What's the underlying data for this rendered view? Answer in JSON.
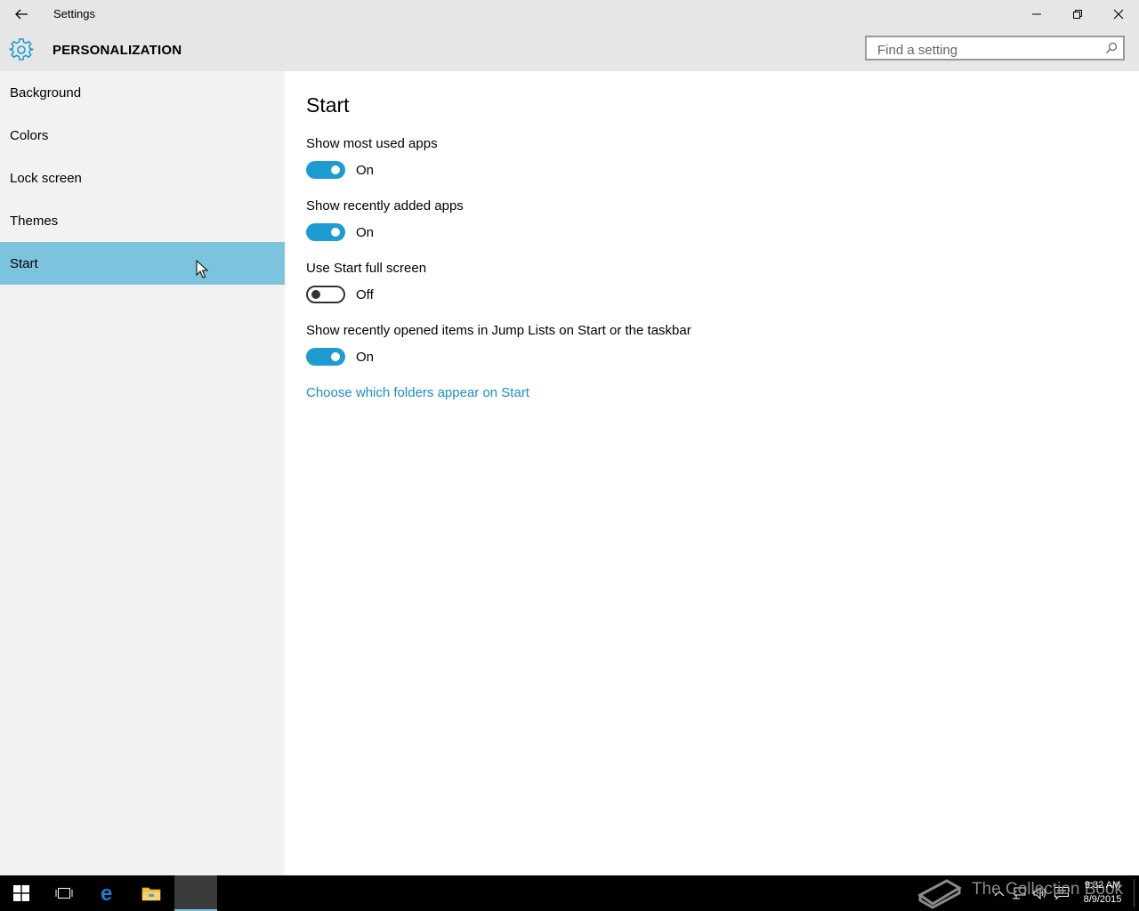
{
  "window": {
    "title": "Settings",
    "header_section": "PERSONALIZATION",
    "search_placeholder": "Find a setting"
  },
  "sidebar": {
    "items": [
      {
        "label": "Background"
      },
      {
        "label": "Colors"
      },
      {
        "label": "Lock screen"
      },
      {
        "label": "Themes"
      },
      {
        "label": "Start",
        "selected": true
      }
    ]
  },
  "main": {
    "title": "Start",
    "settings": [
      {
        "label": "Show most used apps",
        "state": "On",
        "enabled": true
      },
      {
        "label": "Show recently added apps",
        "state": "On",
        "enabled": true
      },
      {
        "label": "Use Start full screen",
        "state": "Off",
        "enabled": false
      },
      {
        "label": "Show recently opened items in Jump Lists on Start or the taskbar",
        "state": "On",
        "enabled": true
      }
    ],
    "link": "Choose which folders appear on Start"
  },
  "taskbar": {
    "watermark": "The Collection Book",
    "time": "9:32 AM",
    "date": "8/9/2015"
  },
  "colors": {
    "accent": "#1e9bd1",
    "selected_nav": "#7cc4dd",
    "link": "#1a8ec2",
    "chrome": "#e6e6e6",
    "sidebar": "#f2f2f2"
  }
}
